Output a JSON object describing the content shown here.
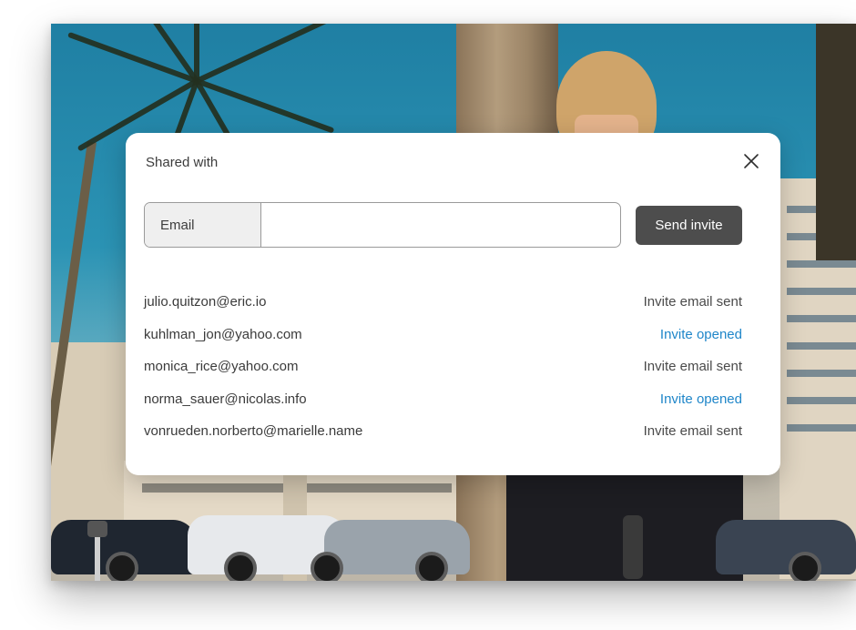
{
  "dialog": {
    "title": "Shared with",
    "close_icon": "close-icon",
    "email_label": "Email",
    "email_value": "",
    "email_placeholder": "",
    "send_label": "Send invite"
  },
  "invites": [
    {
      "email": "julio.quitzon@eric.io",
      "status": "Invite email sent",
      "state": "sent"
    },
    {
      "email": "kuhlman_jon@yahoo.com",
      "status": "Invite opened",
      "state": "opened"
    },
    {
      "email": "monica_rice@yahoo.com",
      "status": "Invite email sent",
      "state": "sent"
    },
    {
      "email": "norma_sauer@nicolas.info",
      "status": "Invite opened",
      "state": "opened"
    },
    {
      "email": "vonrueden.norberto@marielle.name",
      "status": "Invite email sent",
      "state": "sent"
    }
  ],
  "colors": {
    "send_button": "#4d4d4d",
    "status_opened": "#1f86c9",
    "status_sent": "#4a4a4a"
  }
}
